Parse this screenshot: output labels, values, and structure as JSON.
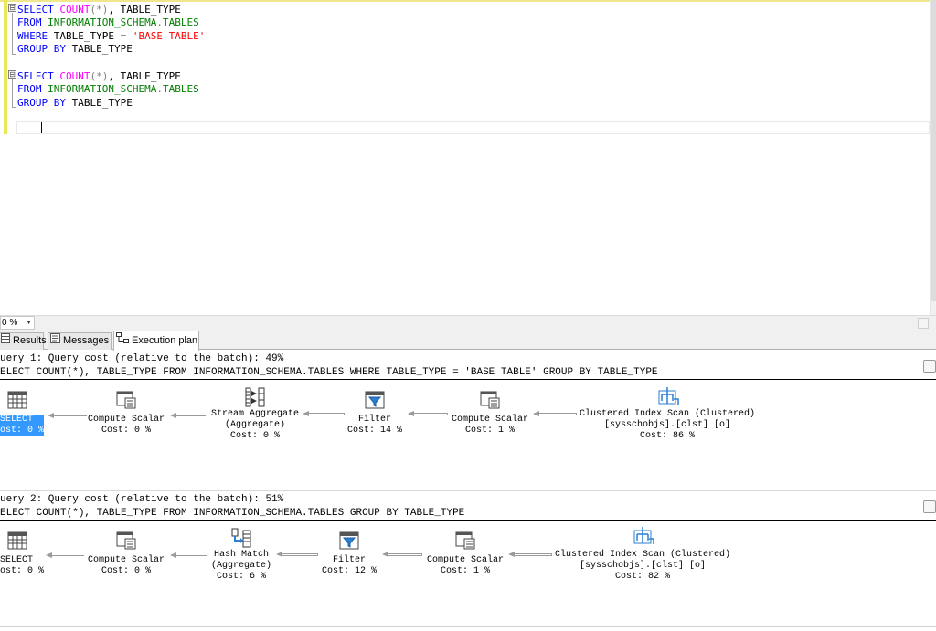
{
  "editor": {
    "lines": [
      {
        "parts": [
          [
            "kw",
            "SELECT "
          ],
          [
            "fn",
            "COUNT"
          ],
          [
            "op",
            "(*)"
          ],
          [
            "plain",
            ", TABLE_TYPE"
          ]
        ]
      },
      {
        "parts": [
          [
            "kw",
            "FROM "
          ],
          [
            "sys",
            "INFORMATION_SCHEMA"
          ],
          [
            "op",
            "."
          ],
          [
            "sys",
            "TABLES"
          ]
        ]
      },
      {
        "parts": [
          [
            "kw",
            "WHERE "
          ],
          [
            "plain",
            "TABLE_TYPE "
          ],
          [
            "op",
            "= "
          ],
          [
            "str",
            "'BASE TABLE'"
          ]
        ]
      },
      {
        "parts": [
          [
            "kw",
            "GROUP BY "
          ],
          [
            "plain",
            "TABLE_TYPE"
          ]
        ]
      },
      {
        "parts": []
      },
      {
        "parts": [
          [
            "kw",
            "SELECT "
          ],
          [
            "fn",
            "COUNT"
          ],
          [
            "op",
            "(*)"
          ],
          [
            "plain",
            ", TABLE_TYPE"
          ]
        ]
      },
      {
        "parts": [
          [
            "kw",
            "FROM "
          ],
          [
            "sys",
            "INFORMATION_SCHEMA"
          ],
          [
            "op",
            "."
          ],
          [
            "sys",
            "TABLES"
          ]
        ]
      },
      {
        "parts": [
          [
            "kw",
            "GROUP BY "
          ],
          [
            "plain",
            "TABLE_TYPE"
          ]
        ]
      }
    ],
    "collapse_symbol": "⊟"
  },
  "zoom": {
    "value": "0 %",
    "arrow": "▼"
  },
  "tabs": {
    "results": "Results",
    "messages": "Messages",
    "execution_plan": "Execution plan"
  },
  "plan": {
    "query1": {
      "header": "uery 1: Query cost (relative to the batch): 49%",
      "sql": "ELECT COUNT(*), TABLE_TYPE FROM INFORMATION_SCHEMA.TABLES WHERE TABLE_TYPE = 'BASE TABLE' GROUP BY TABLE_TYPE",
      "operators": [
        {
          "label": "SELECT\nost: 0 %",
          "icon": "select-icon"
        },
        {
          "label": "Compute Scalar\nCost: 0 %",
          "icon": "compute-scalar-icon"
        },
        {
          "label": "Stream Aggregate\n(Aggregate)\nCost: 0 %",
          "icon": "stream-aggregate-icon"
        },
        {
          "label": "Filter\nCost: 14 %",
          "icon": "filter-icon"
        },
        {
          "label": "Compute Scalar\nCost: 1 %",
          "icon": "compute-scalar-icon"
        },
        {
          "label": "Clustered Index Scan (Clustered)\n[sysschobjs].[clst] [o]\nCost: 86 %",
          "icon": "clustered-index-scan-icon"
        }
      ]
    },
    "query2": {
      "header": "uery 2: Query cost (relative to the batch): 51%",
      "sql": "ELECT COUNT(*), TABLE_TYPE FROM INFORMATION_SCHEMA.TABLES GROUP BY TABLE_TYPE",
      "operators": [
        {
          "label": "SELECT\nost: 0 %",
          "icon": "select-icon"
        },
        {
          "label": "Compute Scalar\nCost: 0 %",
          "icon": "compute-scalar-icon"
        },
        {
          "label": "Hash Match\n(Aggregate)\nCost: 6 %",
          "icon": "hash-match-icon"
        },
        {
          "label": "Filter\nCost: 12 %",
          "icon": "filter-icon"
        },
        {
          "label": "Compute Scalar\nCost: 1 %",
          "icon": "compute-scalar-icon"
        },
        {
          "label": "Clustered Index Scan (Clustered)\n[sysschobjs].[clst] [o]\nCost: 82 %",
          "icon": "clustered-index-scan-icon"
        }
      ]
    }
  },
  "colors": {
    "keyword": "#0000ff",
    "function": "#ff00ff",
    "system_object": "#008000",
    "string": "#ff0000",
    "selection": "#3399ff"
  }
}
